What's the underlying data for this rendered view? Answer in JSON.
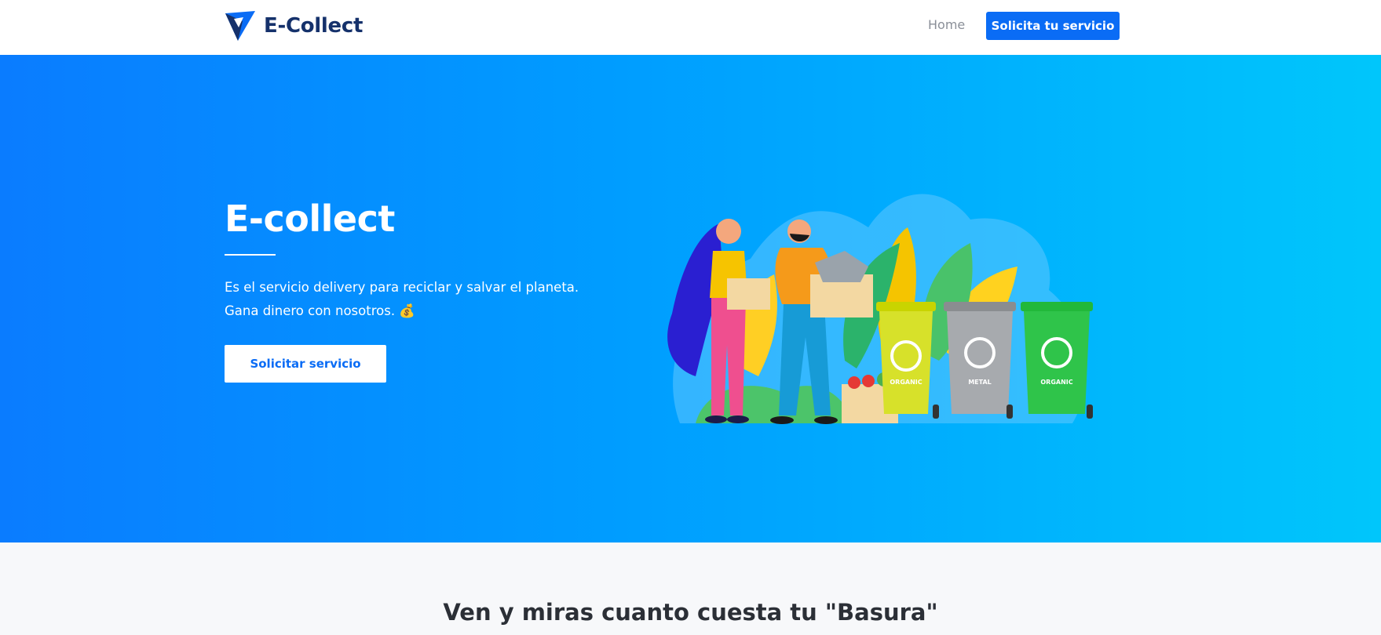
{
  "navbar": {
    "brand_name": "E-Collect",
    "home_label": "Home",
    "cta_label": "Solicita tu servicio"
  },
  "hero": {
    "title": "E-collect",
    "description_line1": "Es el servicio delivery para reciclar y salvar el planeta.",
    "description_line2": "Gana dinero con nosotros. 💰",
    "button_label": "Solicitar servicio",
    "bin_labels": [
      "ORGANIC",
      "METAL",
      "ORGANIC"
    ]
  },
  "section2": {
    "title": "Ven y miras cuanto cuesta tu \"Basura\""
  },
  "colors": {
    "brand": "#15316b",
    "primary": "#0a6cf5",
    "hero_gradient_start": "#0a7cff",
    "hero_gradient_end": "#00c6fb"
  },
  "icons": {
    "logo": "triangle-logo-icon",
    "money_bag": "money-bag-emoji"
  }
}
